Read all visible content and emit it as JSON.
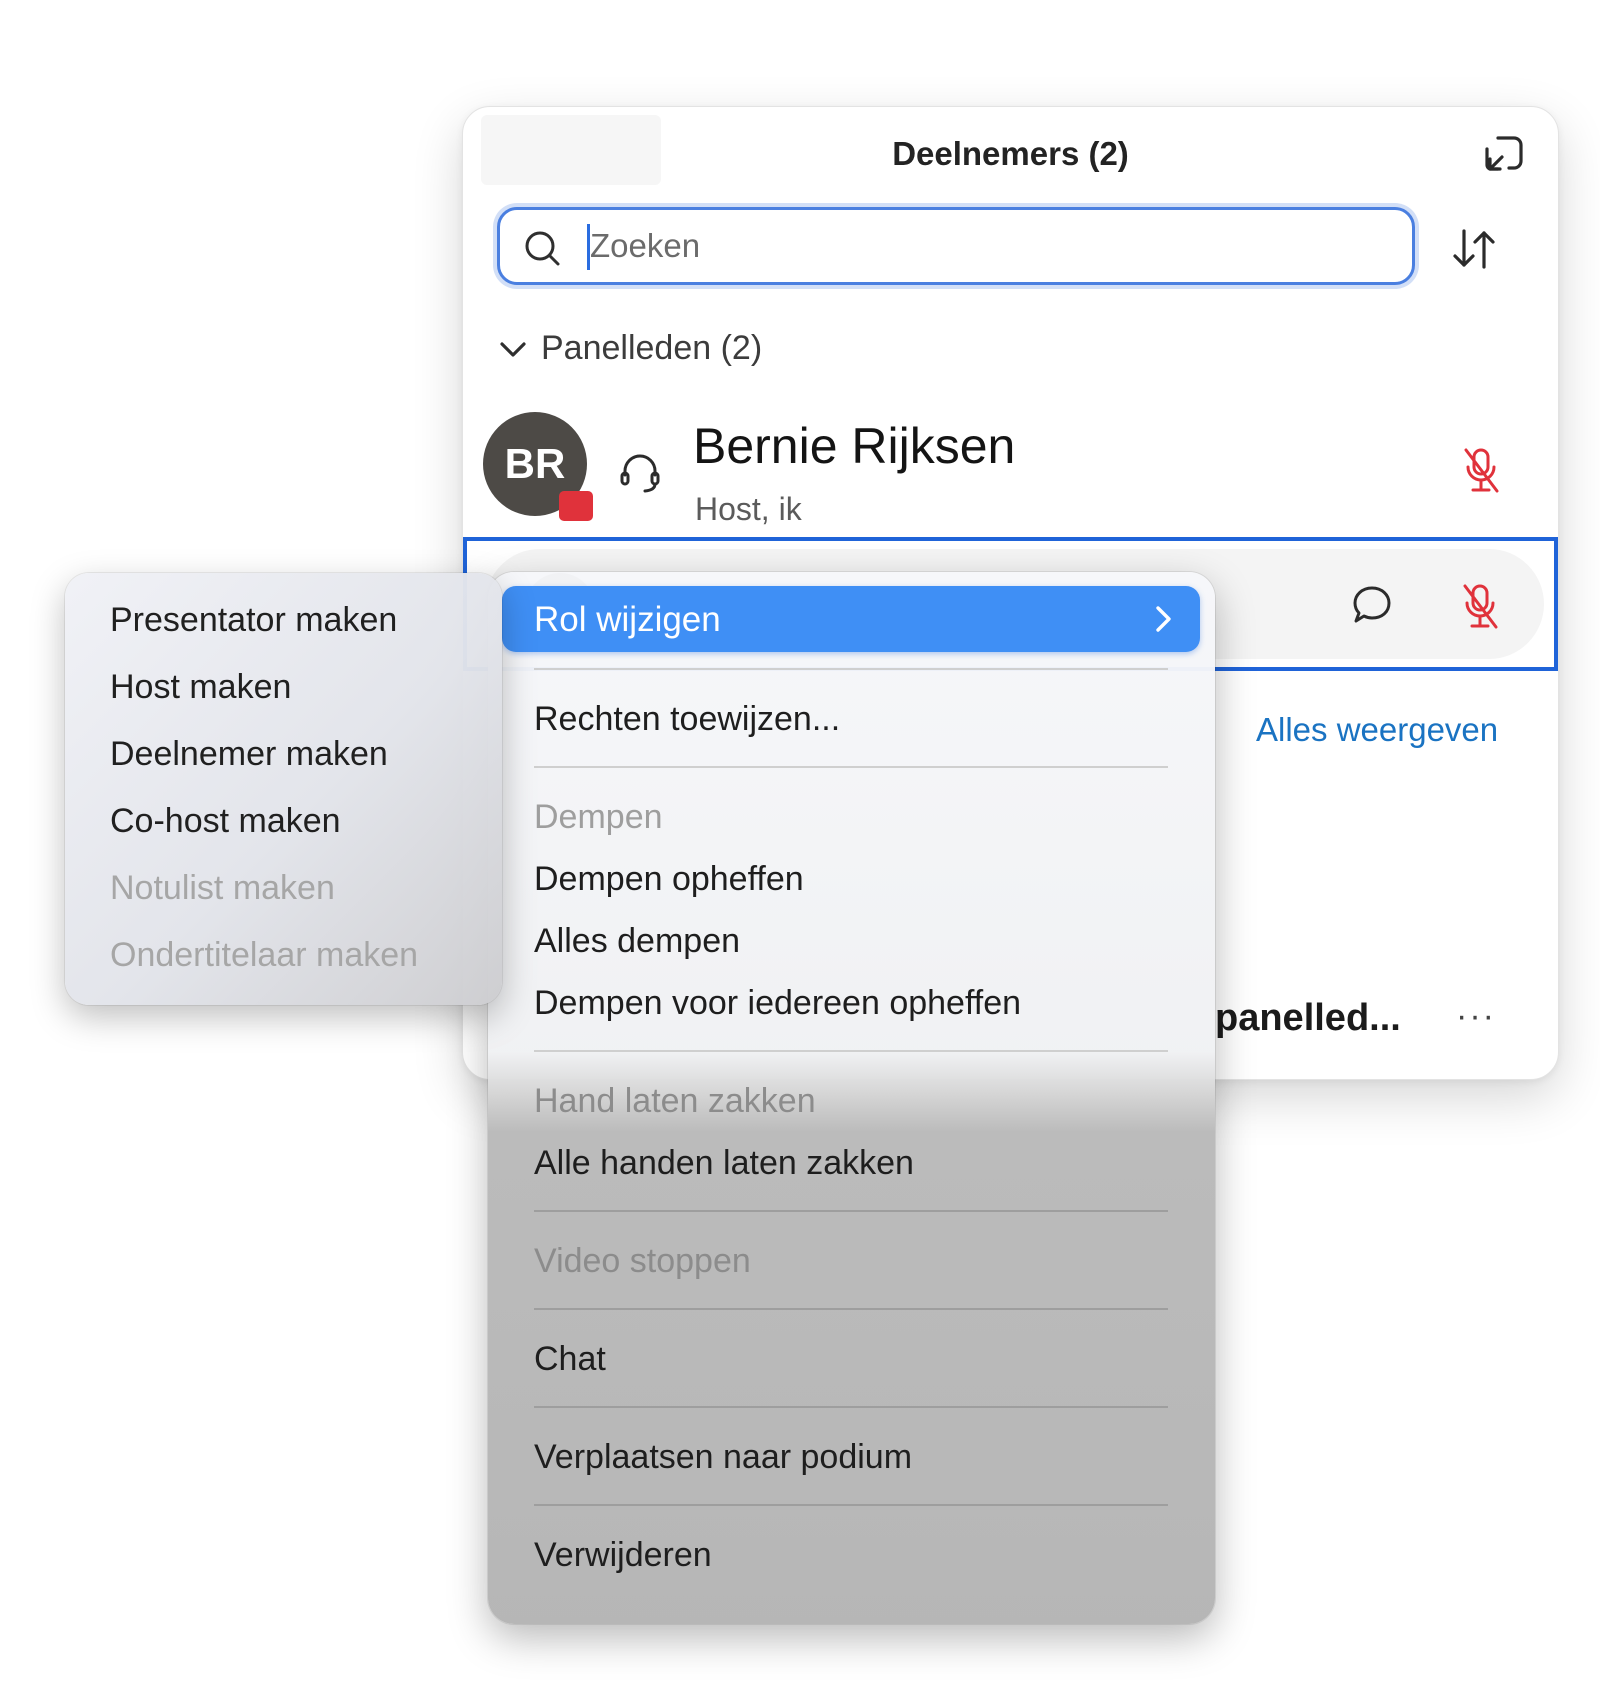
{
  "panel": {
    "title": "Deelnemers (2)",
    "search": {
      "placeholder": "Zoeken"
    },
    "group": {
      "label": "Panelleden (2)"
    },
    "participants": [
      {
        "initials": "BR",
        "name": "Bernie Rijksen",
        "role": "Host, ik"
      }
    ],
    "show_all": "Alles weergeven",
    "partial_text": "panelled...",
    "more": "···",
    "colors": {
      "accent": "#1f63d8",
      "link": "#1a73c2",
      "muted_mic": "#e0323b"
    }
  },
  "context_menu": {
    "highlighted": "Rol wijzigen",
    "items": {
      "rights": "Rechten toewijzen...",
      "mute": "Dempen",
      "unmute": "Dempen opheffen",
      "mute_all": "Alles dempen",
      "unmute_all": "Dempen voor iedereen opheffen",
      "lower_hand": "Hand laten zakken",
      "lower_all_hands": "Alle handen laten zakken",
      "stop_video": "Video stoppen",
      "chat": "Chat",
      "move_stage": "Verplaatsen naar podium",
      "remove": "Verwijderen"
    }
  },
  "role_submenu": {
    "items": [
      "Presentator maken",
      "Host maken",
      "Deelnemer maken",
      "Co-host maken",
      "Notulist maken",
      "Ondertitelaar maken"
    ]
  }
}
